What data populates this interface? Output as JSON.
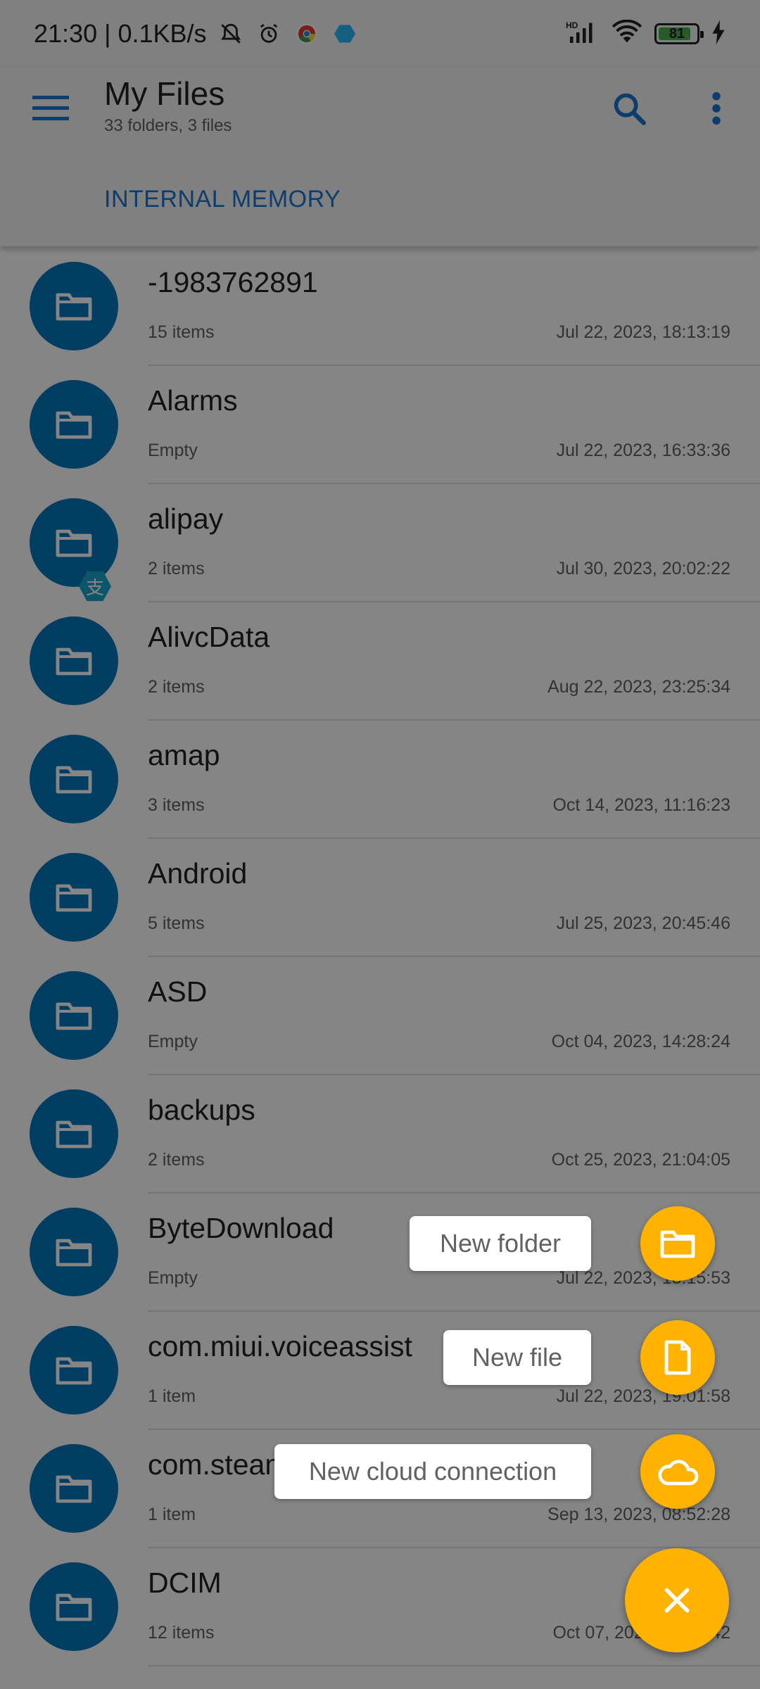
{
  "status_bar": {
    "time_speed": "21:30 | 0.1KB/s",
    "battery": "81",
    "icons": [
      "mute-bell-icon",
      "alarm-icon",
      "chrome-icon",
      "app-notification-icon",
      "hd-signal-icon",
      "wifi-icon",
      "battery-icon",
      "charging-icon"
    ]
  },
  "app_bar": {
    "title": "My Files",
    "subtitle": "33 folders, 3 files",
    "tab": "INTERNAL MEMORY",
    "accent": "#1976d2"
  },
  "files": [
    {
      "name": "-1983762891",
      "meta": "15 items",
      "date": "Jul 22, 2023, 18:13:19"
    },
    {
      "name": "Alarms",
      "meta": "Empty",
      "date": "Jul 22, 2023, 16:33:36"
    },
    {
      "name": "alipay",
      "meta": "2 items",
      "date": "Jul 30, 2023, 20:02:22",
      "badge": "支"
    },
    {
      "name": "AlivcData",
      "meta": "2 items",
      "date": "Aug 22, 2023, 23:25:34"
    },
    {
      "name": "amap",
      "meta": "3 items",
      "date": "Oct 14, 2023, 11:16:23"
    },
    {
      "name": "Android",
      "meta": "5 items",
      "date": "Jul 25, 2023, 20:45:46"
    },
    {
      "name": "ASD",
      "meta": "Empty",
      "date": "Oct 04, 2023, 14:28:24"
    },
    {
      "name": "backups",
      "meta": "2 items",
      "date": "Oct 25, 2023, 21:04:05"
    },
    {
      "name": "ByteDownload",
      "meta": "Empty",
      "date": "Jul 22, 2023, 18:15:53"
    },
    {
      "name": "com.miui.voiceassist",
      "meta": "1 item",
      "date": "Jul 22, 2023, 19:01:58"
    },
    {
      "name": "com.steam",
      "meta": "1 item",
      "date": "Sep 13, 2023, 08:52:28"
    },
    {
      "name": "DCIM",
      "meta": "12 items",
      "date": "Oct 07, 2023, 21:11:42"
    }
  ],
  "fab_menu": {
    "new_folder": "New folder",
    "new_file": "New file",
    "new_cloud": "New cloud connection",
    "fab_color": "#ffb300"
  }
}
